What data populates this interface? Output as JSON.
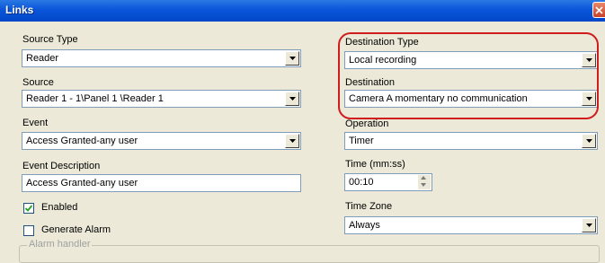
{
  "window": {
    "title": "Links",
    "close_icon": "close-icon"
  },
  "left": {
    "source_type": {
      "label": "Source Type",
      "value": "Reader"
    },
    "source": {
      "label": "Source",
      "value": "Reader 1 - 1\\Panel 1 \\Reader 1"
    },
    "event": {
      "label": "Event",
      "value": "Access Granted-any user"
    },
    "event_description": {
      "label": "Event Description",
      "value": "Access Granted-any user"
    },
    "enabled": {
      "label": "Enabled",
      "checked": true
    },
    "generate_alarm": {
      "label": "Generate Alarm",
      "checked": false
    },
    "alarm_handler": {
      "label": "Alarm handler"
    }
  },
  "right": {
    "destination_type": {
      "label": "Destination Type",
      "value": "Local recording"
    },
    "destination": {
      "label": "Destination",
      "value": "Camera A momentary no communication"
    },
    "operation": {
      "label": "Operation",
      "value": "Timer"
    },
    "time": {
      "label": "Time (mm:ss)",
      "value": "00:10"
    },
    "time_zone": {
      "label": "Time Zone",
      "value": "Always"
    }
  },
  "colors": {
    "title_bar": "#0a55d9",
    "highlight": "#d01c1c",
    "dialog_bg": "#ece9d8",
    "field_border": "#7f9db9"
  }
}
